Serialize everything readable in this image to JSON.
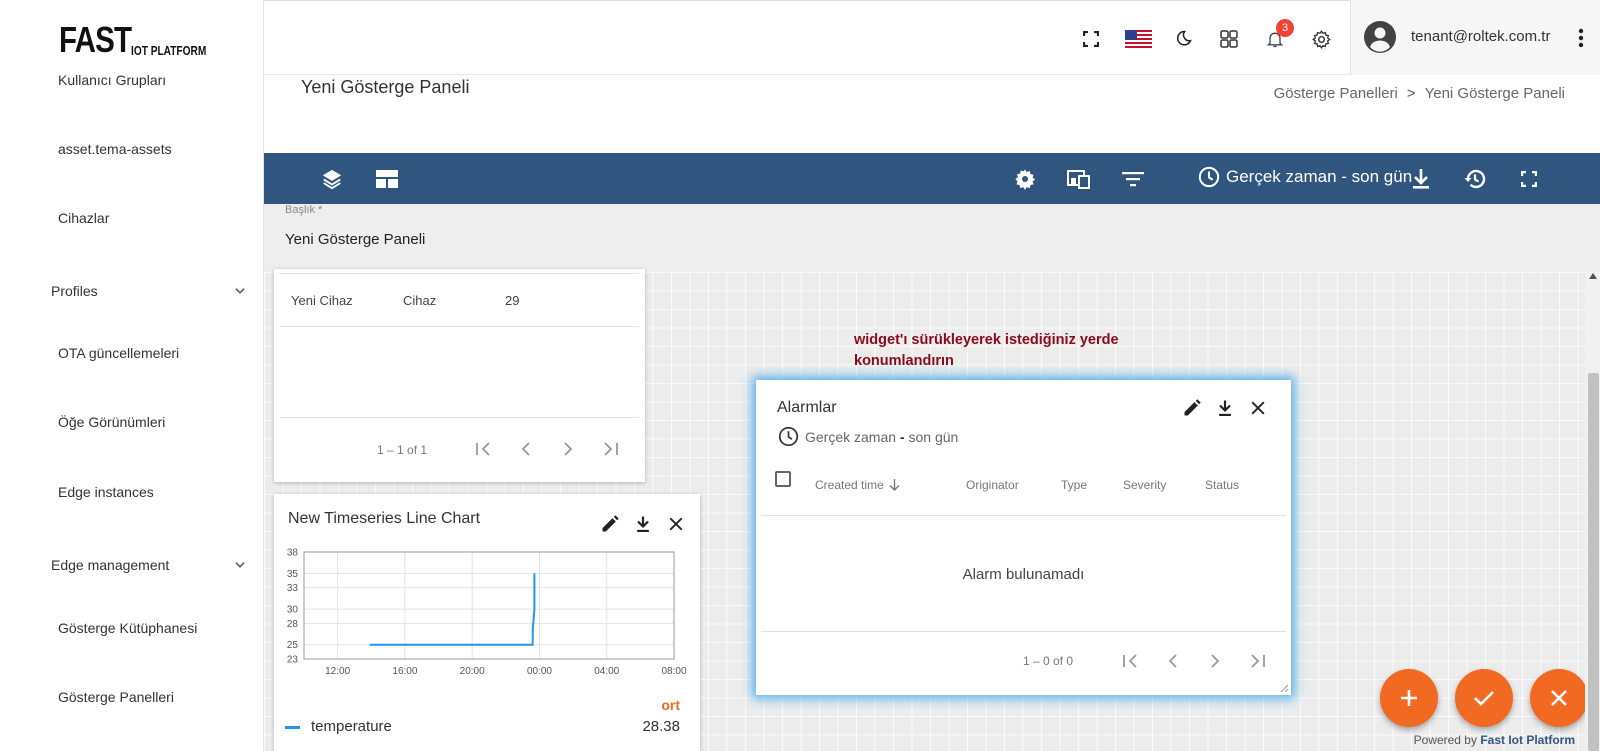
{
  "logo": {
    "big": "FAST",
    "small": "IOT PLATFORM"
  },
  "sidebar": {
    "items": [
      {
        "label": "Kullanıcı Grupları"
      },
      {
        "label": "asset.tema-assets"
      },
      {
        "label": "Cihazlar"
      },
      {
        "label": "Profiles",
        "group": true
      },
      {
        "label": "OTA güncellemeleri"
      },
      {
        "label": "Öğe Görünümleri"
      },
      {
        "label": "Edge instances"
      },
      {
        "label": "Edge management",
        "group": true
      },
      {
        "label": "Gösterge Kütüphanesi"
      },
      {
        "label": "Gösterge Panelleri"
      }
    ]
  },
  "topbar": {
    "notification_count": "3",
    "user_email": "tenant@roltek.com.tr",
    "icons": [
      "fullscreen-icon",
      "us-flag-icon",
      "dark-mode-icon",
      "apps-grid-icon",
      "bell-icon",
      "gear-icon",
      "account-circle-icon",
      "more-vert-icon"
    ]
  },
  "page": {
    "title": "Yeni Gösterge Paneli",
    "breadcrumb": [
      "Gösterge Panelleri",
      ">",
      "Yeni Gösterge Paneli"
    ]
  },
  "toolbar": {
    "time_window": "Gerçek zaman - son gün",
    "color": "#305680"
  },
  "form": {
    "title_label": "Başlık *",
    "title_value": "Yeni Gösterge Paneli"
  },
  "entities_widget": {
    "row": [
      "Yeni Cihaz",
      "Cihaz",
      "29"
    ],
    "pager": "1 – 1 of 1"
  },
  "chart_widget": {
    "title": "New Timeseries Line Chart",
    "legend_header": "ort",
    "legend_series": "temperature",
    "legend_value": "28.38"
  },
  "chart_data": {
    "type": "line",
    "title": "New Timeseries Line Chart",
    "xlabel": "",
    "ylabel": "",
    "x_ticks": [
      "12:00",
      "16:00",
      "20:00",
      "00:00",
      "04:00",
      "08:00"
    ],
    "y_ticks": [
      "23",
      "25",
      "28",
      "30",
      "33",
      "35",
      "38"
    ],
    "ylim": [
      23,
      38
    ],
    "xlim_hours": [
      10,
      32
    ],
    "series": [
      {
        "name": "temperature",
        "color": "#2196f3",
        "x_hours": [
          13.9,
          23.6,
          23.6,
          23.7,
          23.7
        ],
        "values": [
          25,
          25,
          27,
          30,
          35
        ]
      }
    ]
  },
  "alarms_widget": {
    "title": "Alarmlar",
    "time_prefix": "Gerçek zaman",
    "time_sep": " - ",
    "time_suffix": "son gün",
    "columns": [
      "Created time",
      "Originator",
      "Type",
      "Severity",
      "Status"
    ],
    "empty_message": "Alarm bulunamadı",
    "pager": "1 – 0 of 0"
  },
  "hint": "widget'ı sürükleyerek istediğiniz yerde konumlandırın",
  "footer": {
    "powered_prefix": "Powered by",
    "powered_brand": "Fast Iot Platform"
  },
  "colors": {
    "accent": "#f26922",
    "primary": "#305680",
    "badge": "#f44336"
  }
}
